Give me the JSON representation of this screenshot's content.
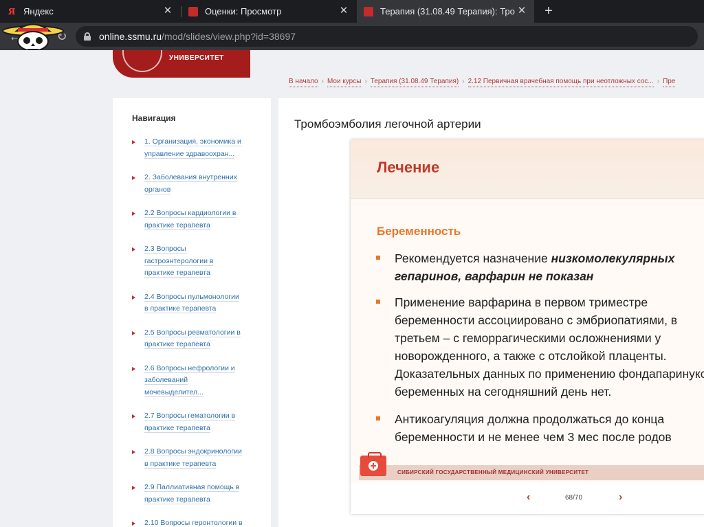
{
  "browser": {
    "tabs": [
      {
        "title": "Яндекс",
        "favicon": "yandex-icon"
      },
      {
        "title": "Оценки: Просмотр",
        "favicon": "university-crest-icon"
      },
      {
        "title": "Терапия (31.08.49 Терапия): Тро",
        "favicon": "university-crest-icon"
      }
    ],
    "url_host": "online.ssmu.ru",
    "url_path": "/mod/slides/view.php?id=38697"
  },
  "header": {
    "university": "УНИВЕРСИТЕТ"
  },
  "breadcrumbs": [
    "В начало",
    "Мои курсы",
    "Терапия (31.08.49 Терапия)",
    "2.12 Первичная врачебная помощь при неотложных сос...",
    "Пре"
  ],
  "sidebar": {
    "title": "Навигация",
    "items": [
      {
        "lines": [
          "1. Организация, экономика и",
          "управление здравоохран..."
        ]
      },
      {
        "lines": [
          "2. Заболевания внутренних",
          "органов"
        ]
      },
      {
        "lines": [
          "2.2 Вопросы кардиологии в",
          "практике терапевта"
        ]
      },
      {
        "lines": [
          "2.3 Вопросы",
          "гастроэнтерологии в",
          "практике терапевта"
        ]
      },
      {
        "lines": [
          "2.4 Вопросы пульмонологии",
          "в практике терапевта"
        ]
      },
      {
        "lines": [
          "2.5 Вопросы ревматологии в",
          "практике терапевта"
        ]
      },
      {
        "lines": [
          "2.6 Вопросы нефрологии и",
          "заболеваний",
          "мочевыделител..."
        ]
      },
      {
        "lines": [
          "2.7 Вопросы гематологии в",
          "практике терапевта"
        ]
      },
      {
        "lines": [
          "2.8 Вопросы эндокринологии",
          "в практике терапевта"
        ]
      },
      {
        "lines": [
          "2.9 Паллиативная помощь в",
          "практике терапевта"
        ]
      },
      {
        "lines": [
          "2.10 Вопросы геронтологии в"
        ]
      }
    ]
  },
  "main": {
    "page_title": "Тромбоэмболия легочной артерии",
    "slide": {
      "title": "Лечение",
      "subtitle": "Беременность",
      "b1_l1_plain": "Рекомендуется назначение ",
      "b1_l1_bold": "низкомолекулярных",
      "b1_l2_bold": "гепаринов, варфарин не показан",
      "b2_lines": [
        "Применение варфарина в первом триместре",
        "беременности ассоциировано с эмбриопатиями, в",
        "третьем – с геморрагическими осложнениями у",
        "новорожденного, а также с отслойкой плаценты.",
        "Доказательных данных по применению фондапаринукса у",
        "беременных на сегодняшний день нет."
      ],
      "b3_lines": [
        "Антикоагуляция должна продолжаться до конца",
        "беременности и не менее чем 3 мес после родов"
      ],
      "footer": "СИБИРСКИЙ ГОСУДАРСТВЕННЫЙ МЕДИЦИНСКИЙ УНИВЕРСИТЕТ"
    },
    "pager": {
      "prev": "‹",
      "page": "68/70",
      "next": "›"
    }
  }
}
